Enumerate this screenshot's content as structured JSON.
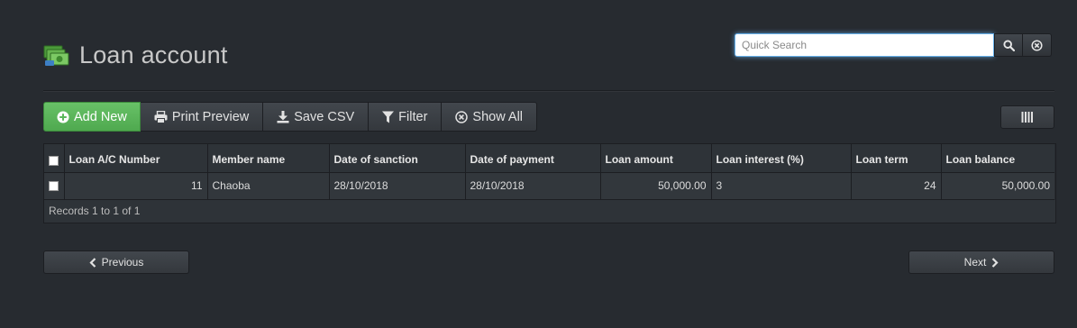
{
  "header": {
    "title": "Loan account",
    "icon": "money-icon"
  },
  "search": {
    "placeholder": "Quick Search",
    "value": ""
  },
  "toolbar": {
    "add_new": "Add New",
    "print_preview": "Print Preview",
    "save_csv": "Save CSV",
    "filter": "Filter",
    "show_all": "Show All"
  },
  "table": {
    "columns": [
      "Loan A/C Number",
      "Member name",
      "Date of sanction",
      "Date of payment",
      "Loan amount",
      "Loan interest (%)",
      "Loan term",
      "Loan balance"
    ],
    "rows": [
      [
        "11",
        "Chaoba",
        "28/10/2018",
        "28/10/2018",
        "50,000.00",
        "3",
        "24",
        "50,000.00"
      ]
    ],
    "footer": "Records 1 to 1 of 1"
  },
  "pager": {
    "previous": "Previous",
    "next": "Next"
  },
  "colors": {
    "background": "#272b30",
    "primary_button": "#5cb85c",
    "search_focus": "#66afe9"
  }
}
